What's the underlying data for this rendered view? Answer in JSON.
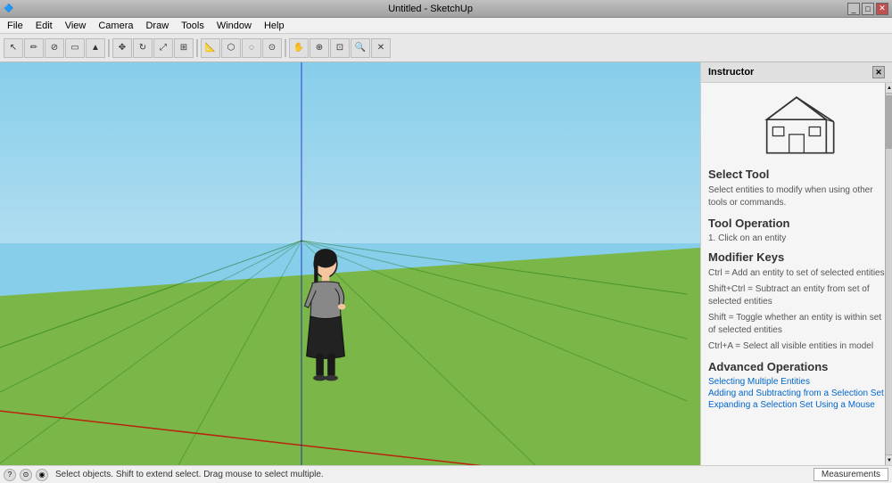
{
  "titlebar": {
    "title": "Untitled - SketchUp",
    "min_label": "_",
    "max_label": "□",
    "close_label": "✕"
  },
  "menubar": {
    "items": [
      "File",
      "Edit",
      "View",
      "Camera",
      "Draw",
      "Tools",
      "Window",
      "Help"
    ]
  },
  "toolbar": {
    "buttons": [
      {
        "name": "select-tool",
        "symbol": "↖"
      },
      {
        "name": "pencil-tool",
        "symbol": "✏"
      },
      {
        "name": "erase-tool",
        "symbol": "◌"
      },
      {
        "name": "polygon-tool",
        "symbol": "⬡"
      },
      {
        "name": "push-pull-tool",
        "symbol": "▲"
      },
      {
        "name": "move-tool",
        "symbol": "✥"
      },
      {
        "name": "rotate-tool",
        "symbol": "↻"
      },
      {
        "name": "scale-tool",
        "symbol": "⤢"
      },
      {
        "name": "offset-tool",
        "symbol": "⊞"
      },
      {
        "name": "tape-tool",
        "symbol": "📏"
      },
      {
        "name": "paint-tool",
        "symbol": "🎨"
      },
      {
        "name": "orbit-tool",
        "symbol": "⊙"
      },
      {
        "name": "pan-tool",
        "symbol": "✋"
      },
      {
        "name": "zoom-tool",
        "symbol": "🔍"
      },
      {
        "name": "zoom-fit",
        "symbol": "⊡"
      },
      {
        "name": "previous-view",
        "symbol": "◁"
      },
      {
        "name": "walk-tool",
        "symbol": "👣"
      }
    ]
  },
  "instructor": {
    "header": "Instructor",
    "tool_name": "Select Tool",
    "tool_desc": "Select entities to modify when using other tools or commands.",
    "section_operation": "Tool Operation",
    "operation_steps": [
      "1.  Click on an entity"
    ],
    "section_modifier": "Modifier Keys",
    "modifier_keys": [
      "Ctrl = Add an entity to set of selected entities",
      "Shift+Ctrl = Subtract an entity from set of selected entities",
      "Shift = Toggle whether an entity is within set of selected entities",
      "Ctrl+A = Select all visible entities in model"
    ],
    "section_advanced": "Advanced Operations",
    "advanced_links": [
      "Selecting Multiple Entities",
      "Adding and Subtracting from a Selection Set",
      "Expanding a Selection Set Using a Mouse"
    ]
  },
  "statusbar": {
    "text": "Select objects. Shift to extend select. Drag mouse to select multiple.",
    "measurements_label": "Measurements"
  }
}
